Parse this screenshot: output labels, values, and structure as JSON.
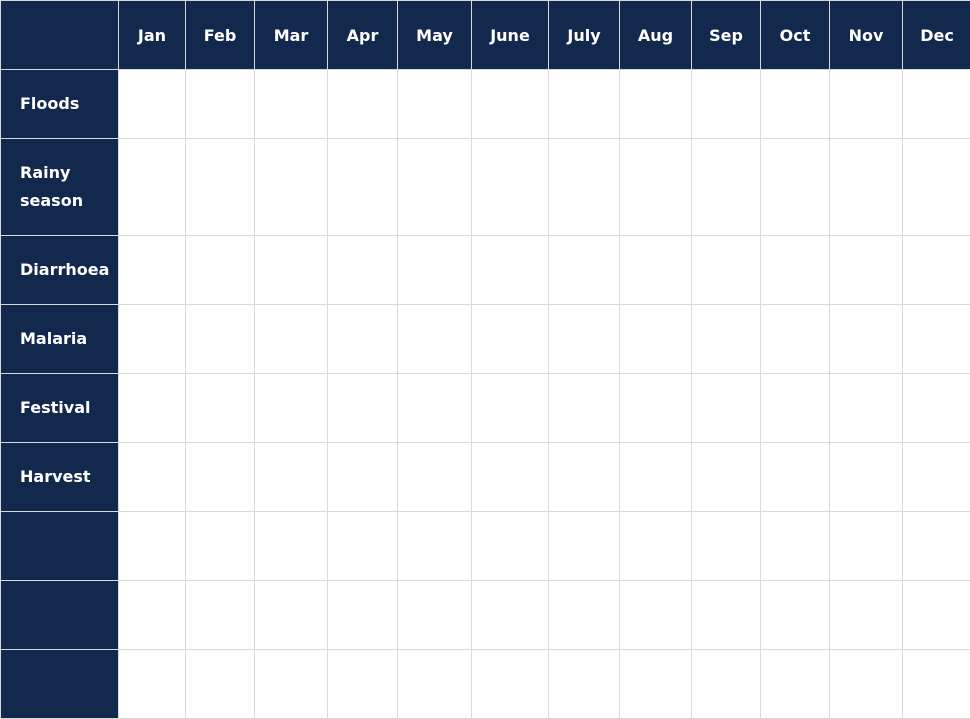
{
  "calendar": {
    "months": [
      "Jan",
      "Feb",
      "Mar",
      "Apr",
      "May",
      "June",
      "July",
      "Aug",
      "Sep",
      "Oct",
      "Nov",
      "Dec"
    ],
    "rows": [
      {
        "label": "Floods"
      },
      {
        "label": "Rainy season"
      },
      {
        "label": "Diarrhoea"
      },
      {
        "label": "Malaria"
      },
      {
        "label": "Festival"
      },
      {
        "label": "Harvest"
      },
      {
        "label": ""
      },
      {
        "label": ""
      },
      {
        "label": ""
      }
    ],
    "colors": {
      "header_bg": "#13284d",
      "header_text": "#ffffff",
      "grid_line": "#d9d9d9",
      "cell_bg": "#ffffff"
    }
  }
}
